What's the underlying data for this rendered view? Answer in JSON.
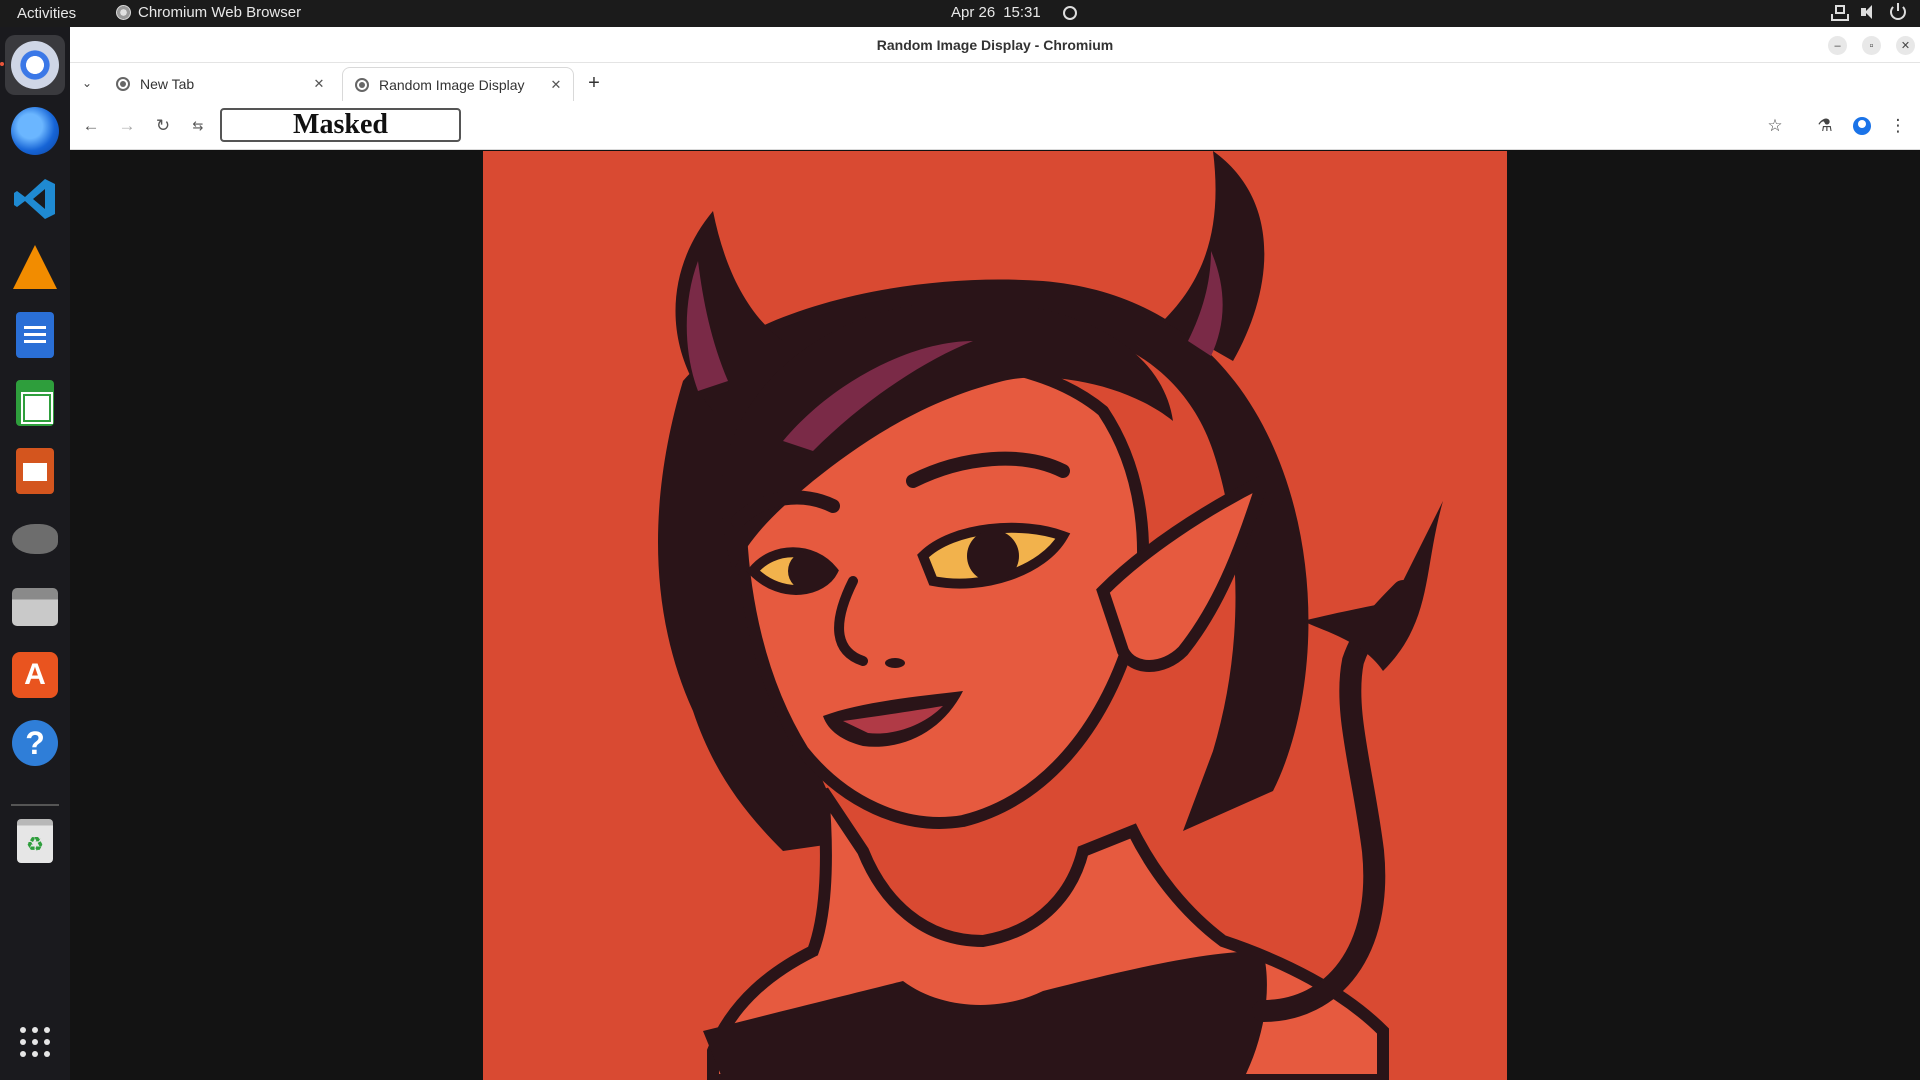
{
  "topbar": {
    "activities": "Activities",
    "app_name": "Chromium Web Browser",
    "date": "Apr 26",
    "time": "15:31"
  },
  "dock": {
    "items": [
      {
        "name": "chromium-icon",
        "active": true
      },
      {
        "name": "thunderbird-icon"
      },
      {
        "name": "vscode-icon"
      },
      {
        "name": "vlc-icon"
      },
      {
        "name": "libreoffice-writer-icon"
      },
      {
        "name": "libreoffice-calc-icon"
      },
      {
        "name": "libreoffice-impress-icon"
      },
      {
        "name": "gimp-icon"
      },
      {
        "name": "files-icon"
      },
      {
        "name": "app-center-icon"
      },
      {
        "name": "help-icon"
      },
      {
        "name": "trash-icon"
      },
      {
        "name": "show-apps-icon"
      }
    ]
  },
  "window": {
    "title": "Random Image Display - Chromium"
  },
  "tabs": [
    {
      "label": "New Tab",
      "active": false
    },
    {
      "label": "Random Image Display",
      "active": true
    }
  ],
  "toolbar": {
    "address": "Masked"
  },
  "content": {
    "image_description_icon": "devil-girl-illustration",
    "colors": {
      "background": "#d94a32",
      "ink": "#2a1418",
      "eyes": "#f2b24c",
      "accent": "#7a2a47"
    }
  }
}
